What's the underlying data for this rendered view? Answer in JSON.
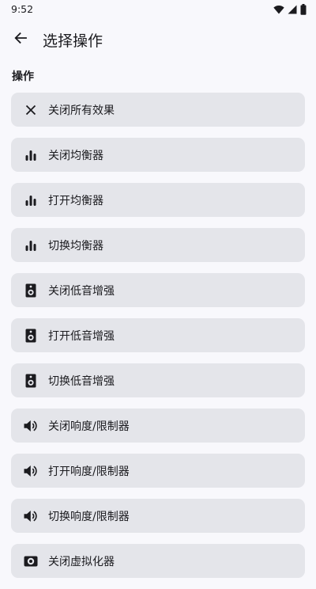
{
  "status_bar": {
    "time": "9:52",
    "icons": [
      "wifi-icon",
      "signal-icon",
      "battery-icon"
    ]
  },
  "app_bar": {
    "back_icon": "arrow-back-icon",
    "title": "选择操作"
  },
  "section": {
    "title": "操作"
  },
  "actions": [
    {
      "icon": "close-icon",
      "label": "关闭所有效果"
    },
    {
      "icon": "equalizer-icon",
      "label": "关闭均衡器"
    },
    {
      "icon": "equalizer-icon",
      "label": "打开均衡器"
    },
    {
      "icon": "equalizer-icon",
      "label": "切换均衡器"
    },
    {
      "icon": "speaker-icon",
      "label": "关闭低音增强"
    },
    {
      "icon": "speaker-icon",
      "label": "打开低音增强"
    },
    {
      "icon": "speaker-icon",
      "label": "切换低音增强"
    },
    {
      "icon": "volume-icon",
      "label": "关闭响度/限制器"
    },
    {
      "icon": "volume-icon",
      "label": "打开响度/限制器"
    },
    {
      "icon": "volume-icon",
      "label": "切换响度/限制器"
    },
    {
      "icon": "virtualizer-icon",
      "label": "关闭虚拟化器"
    }
  ],
  "colors": {
    "background": "#f8f8fc",
    "item_background": "#e4e5ea",
    "text": "#1b1b1f"
  }
}
